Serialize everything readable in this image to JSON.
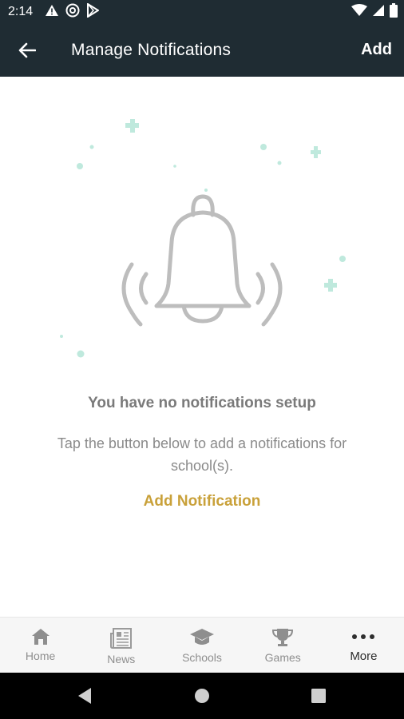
{
  "status_bar": {
    "time": "2:14",
    "left_icons": [
      "warning-icon",
      "at-sign-icon",
      "play-store-icon"
    ],
    "right_icons": [
      "wifi-icon",
      "signal-icon",
      "battery-icon"
    ]
  },
  "app_bar": {
    "title": "Manage Notifications",
    "add_label": "Add",
    "back_icon": "arrow-left-icon",
    "background": "#1f2c33"
  },
  "empty_state": {
    "title": "You have no notifications setup",
    "description": "Tap the button below to add a notifications for school(s).",
    "action_label": "Add Notification",
    "accent_color": "#c9a13a",
    "illustration_icon": "bell-ringing-icon"
  },
  "bottom_nav": {
    "items": [
      {
        "label": "Home",
        "icon": "home-icon"
      },
      {
        "label": "News",
        "icon": "newspaper-icon"
      },
      {
        "label": "Schools",
        "icon": "graduation-cap-icon"
      },
      {
        "label": "Games",
        "icon": "trophy-icon"
      },
      {
        "label": "More",
        "icon": "more-horizontal-icon"
      }
    ],
    "active_label": "More"
  },
  "system_nav": {
    "icons": [
      "back-triangle-icon",
      "home-circle-icon",
      "recents-square-icon"
    ]
  }
}
